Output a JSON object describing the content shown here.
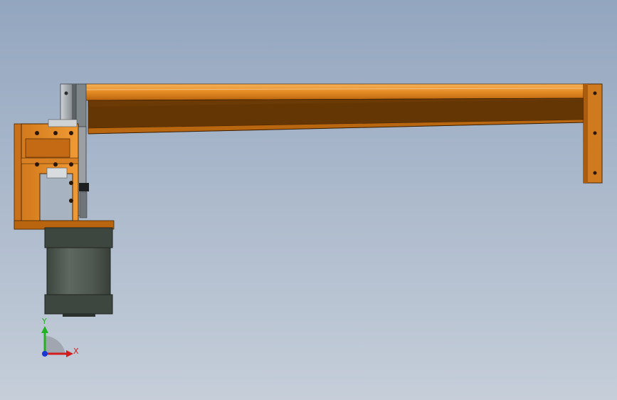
{
  "triad": {
    "y_label": "Y",
    "x_label": "X"
  },
  "colors": {
    "arm_light": "#e9932a",
    "arm_mid": "#c9701a",
    "arm_dark": "#6b3a05",
    "motor_body": "#545d55",
    "motor_dark": "#3b423c",
    "plate_gray": "#8d9296",
    "axis_y": "#22b322",
    "axis_x": "#d11d1d",
    "axis_z": "#1a36d6"
  }
}
